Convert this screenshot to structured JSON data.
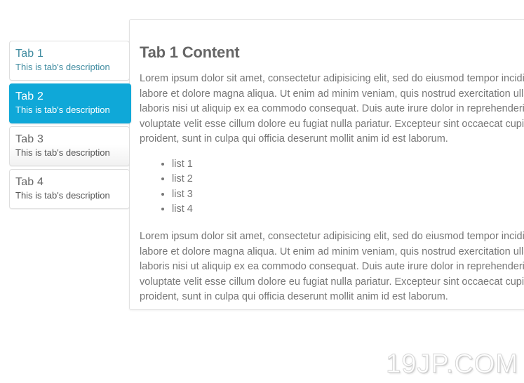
{
  "tabs": {
    "items": [
      {
        "title": "Tab 1",
        "description": "This is tab's description",
        "state": "first"
      },
      {
        "title": "Tab 2",
        "description": "This is tab's description",
        "state": "active"
      },
      {
        "title": "Tab 3",
        "description": "This is tab's description",
        "state": "gradient"
      },
      {
        "title": "Tab 4",
        "description": "This is tab's description",
        "state": "default"
      }
    ]
  },
  "panel": {
    "heading": "Tab 1 Content",
    "paragraph_1": "Lorem ipsum dolor sit amet, consectetur adipisicing elit, sed do eiusmod tempor incididunt ut labore et dolore magna aliqua. Ut enim ad minim veniam, quis nostrud exercitation ullamco laboris nisi ut aliquip ex ea commodo consequat. Duis aute irure dolor in reprehenderit in voluptate velit esse cillum dolore eu fugiat nulla pariatur. Excepteur sint occaecat cupidatat non proident, sunt in culpa qui officia deserunt mollit anim id est laborum.",
    "paragraph_2": "Lorem ipsum dolor sit amet, consectetur adipisicing elit, sed do eiusmod tempor incididunt ut labore et dolore magna aliqua. Ut enim ad minim veniam, quis nostrud exercitation ullamco laboris nisi ut aliquip ex ea commodo consequat. Duis aute irure dolor in reprehenderit in voluptate velit esse cillum dolore eu fugiat nulla pariatur. Excepteur sint occaecat cupidatat non proident, sunt in culpa qui officia deserunt mollit anim id est laborum.",
    "list": [
      "list 1",
      "list 2",
      "list 3",
      "list 4"
    ]
  },
  "watermark": {
    "text": "19JP.COM"
  },
  "colors": {
    "active_tab": "#0fa8d8",
    "first_tab_text": "#3f8ba0",
    "heading_text": "#666666",
    "body_text": "#777777",
    "tab_border": "#dedede",
    "panel_border": "#e2e2e2",
    "page_background": "#ffffff"
  }
}
